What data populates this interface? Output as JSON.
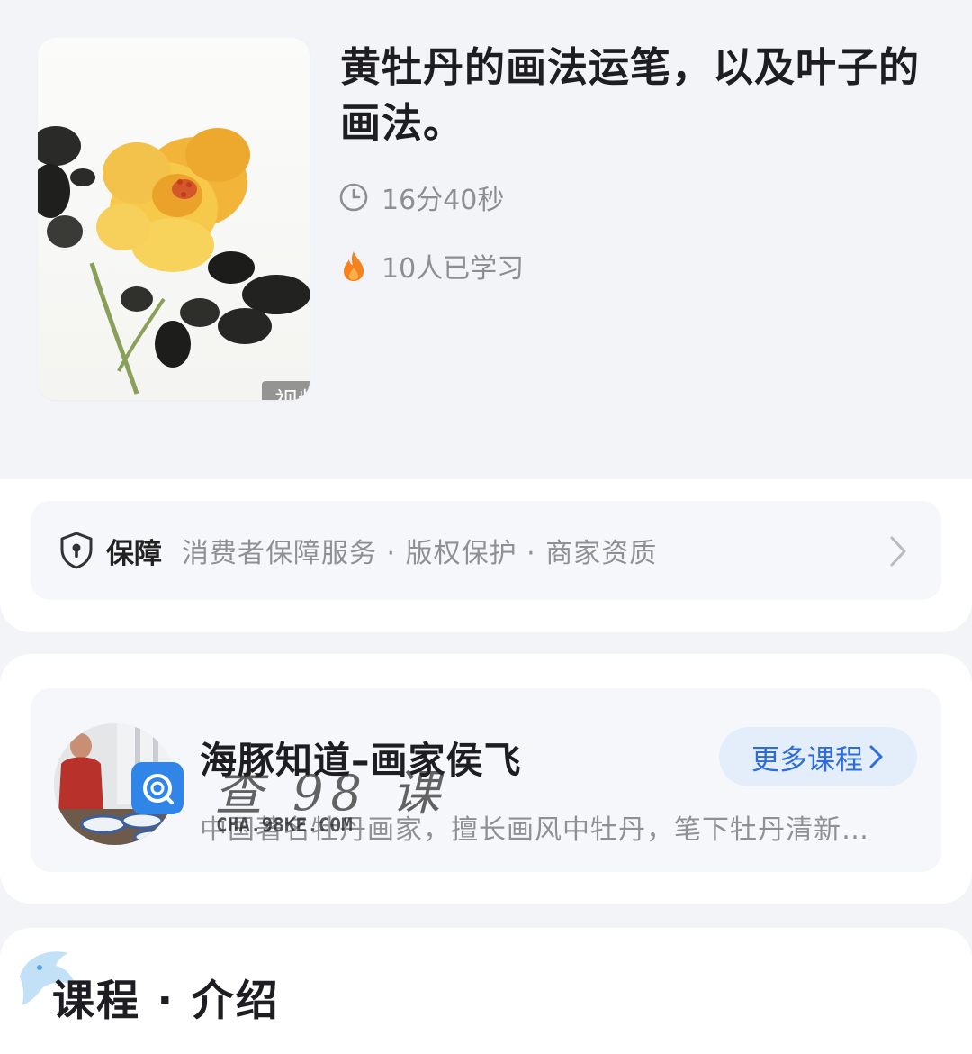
{
  "course": {
    "title": "黄牡丹的画法运笔，以及叶子的画法。",
    "cover_badge": "视频",
    "duration": "16分40秒",
    "learners": "10人已学习",
    "duration_icon": "clock-icon",
    "learners_icon": "fire-icon"
  },
  "guarantee": {
    "label": "保障",
    "text": "消费者保障服务 · 版权保护 · 商家资质",
    "icon": "shield-icon"
  },
  "teacher": {
    "name": "海豚知道–画家侯飞",
    "description": "中国著名牡丹画家，擅长画风中牡丹，笔下牡丹清新…",
    "more_button": "更多课程"
  },
  "watermark": {
    "big": "查 98 课",
    "small": "CHA.98KE.COM"
  },
  "intro": {
    "title": "课程 · 介绍"
  },
  "colors": {
    "accent": "#2d6cdf",
    "fire": "#f5821f",
    "page_bg": "#f3f4f8"
  }
}
